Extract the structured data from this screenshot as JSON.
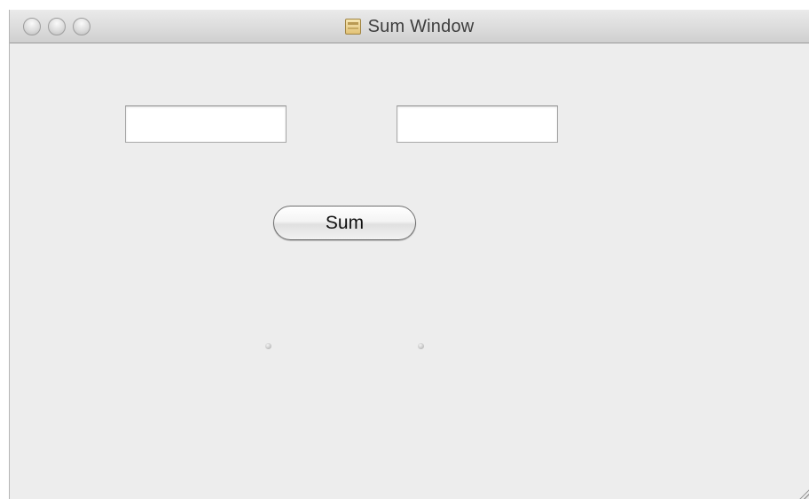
{
  "window": {
    "title": "Sum Window",
    "title_icon": "document-icon",
    "controls": [
      "close",
      "minimize",
      "zoom"
    ]
  },
  "inputs": {
    "first": {
      "value": ""
    },
    "second": {
      "value": ""
    }
  },
  "buttons": {
    "sum_label": "Sum"
  },
  "result_labels": {
    "first": "",
    "second": ""
  },
  "colors": {
    "window_background": "#ededed",
    "titlebar_top": "#eaeaea",
    "titlebar_bottom": "#cfcfcf",
    "field_background": "#ffffff"
  }
}
